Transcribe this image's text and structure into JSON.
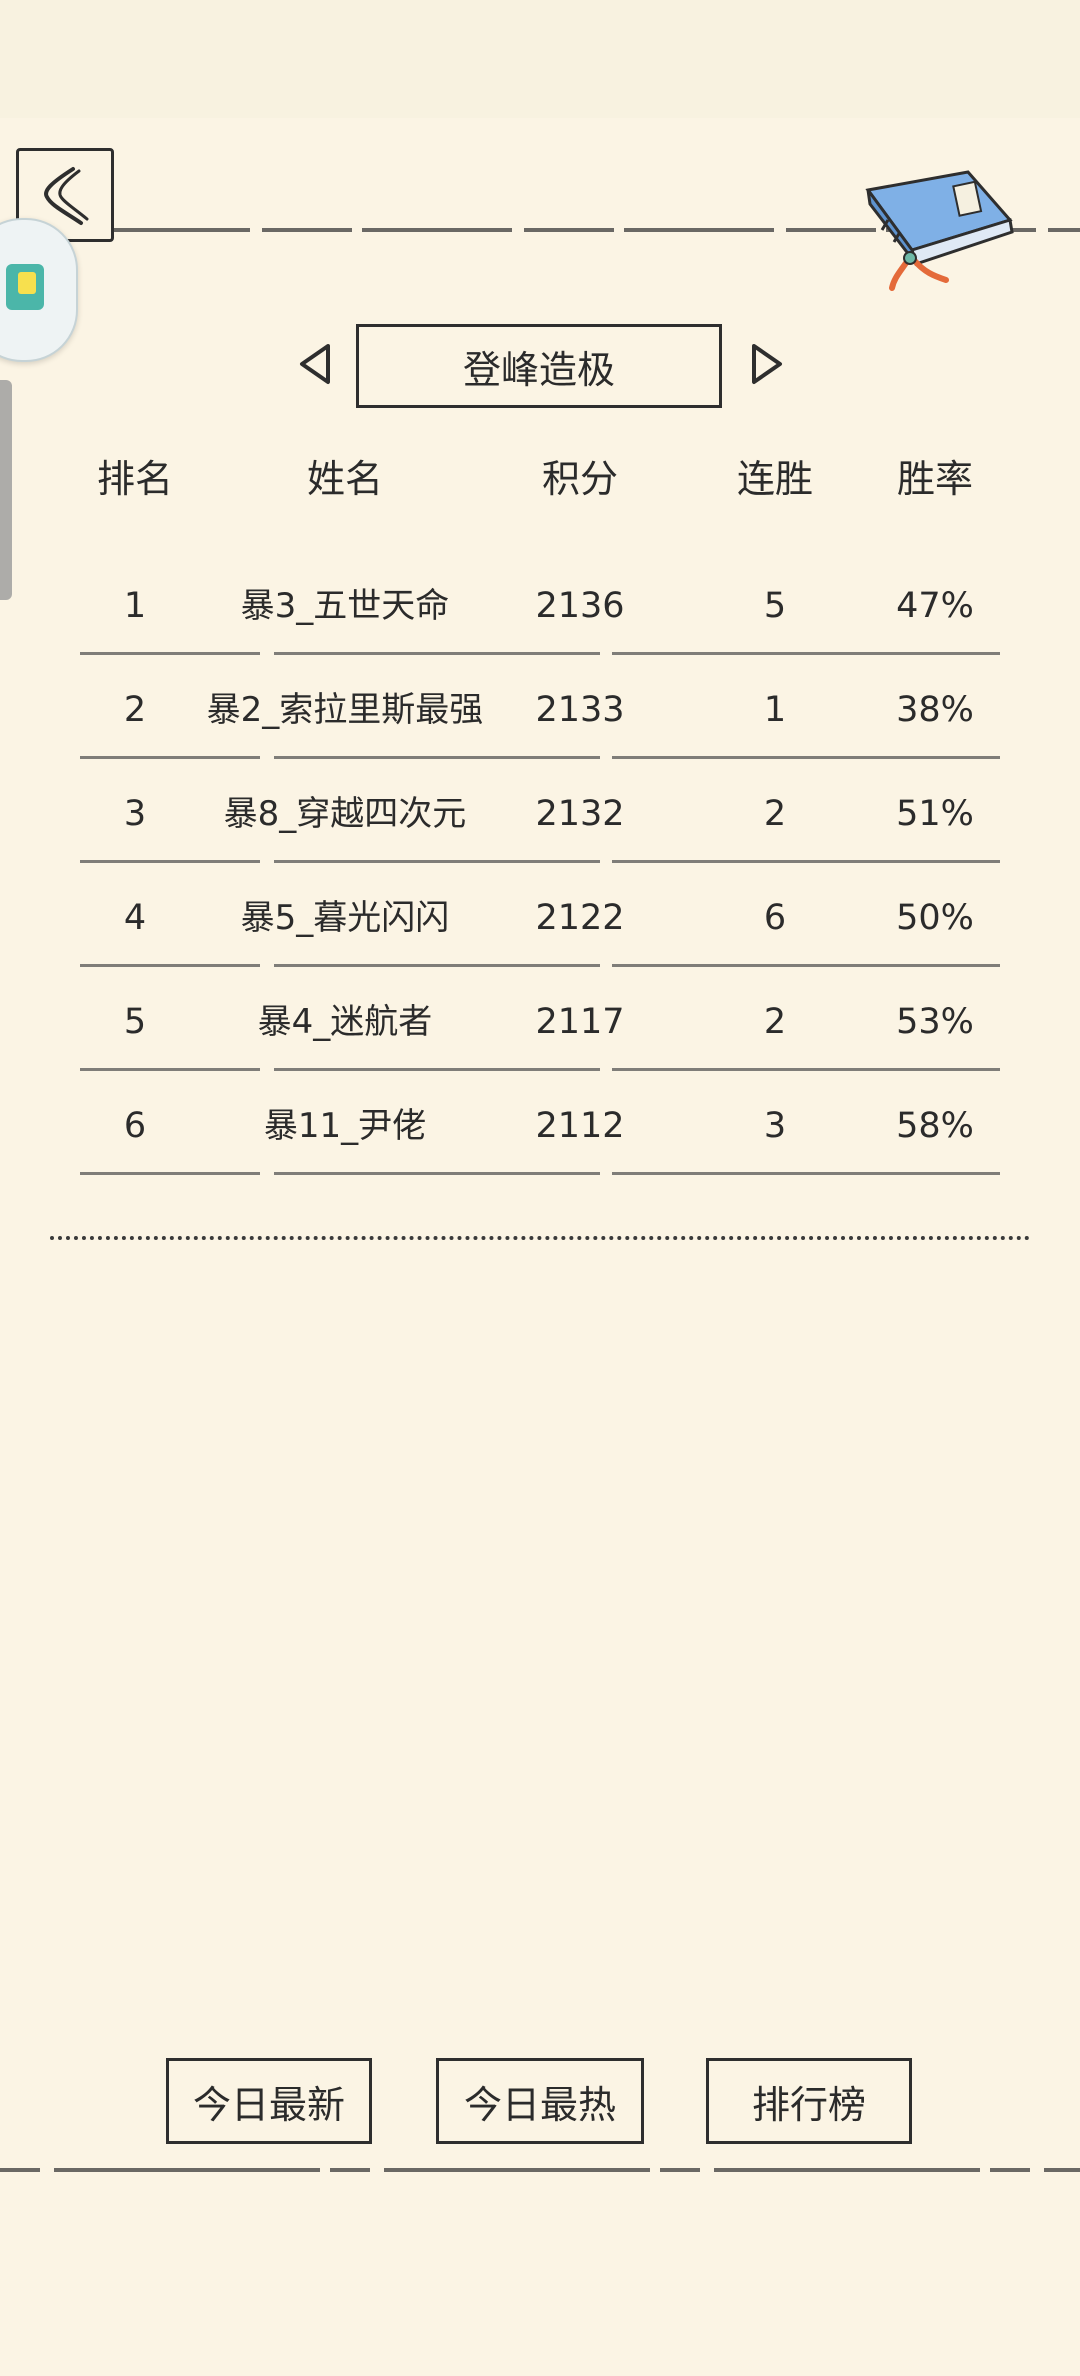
{
  "header": {
    "back_icon": "back-chevron-icon",
    "book_icon": "book-scroll-icon"
  },
  "category": {
    "title": "登峰造极",
    "prev_icon": "triangle-left-icon",
    "next_icon": "triangle-right-icon"
  },
  "table": {
    "headers": {
      "rank": "排名",
      "name": "姓名",
      "score": "积分",
      "streak": "连胜",
      "rate": "胜率"
    },
    "rows": [
      {
        "rank": "1",
        "name": "暴3_五世天命",
        "score": "2136",
        "streak": "5",
        "rate": "47%"
      },
      {
        "rank": "2",
        "name": "暴2_索拉里斯最强",
        "score": "2133",
        "streak": "1",
        "rate": "38%"
      },
      {
        "rank": "3",
        "name": "暴8_穿越四次元",
        "score": "2132",
        "streak": "2",
        "rate": "51%"
      },
      {
        "rank": "4",
        "name": "暴5_暮光闪闪",
        "score": "2122",
        "streak": "6",
        "rate": "50%"
      },
      {
        "rank": "5",
        "name": "暴4_迷航者",
        "score": "2117",
        "streak": "2",
        "rate": "53%"
      },
      {
        "rank": "6",
        "name": "暴11_尹佬",
        "score": "2112",
        "streak": "3",
        "rate": "58%"
      }
    ]
  },
  "bottom_nav": {
    "today_latest": "今日最新",
    "today_hot": "今日最热",
    "leaderboard": "排行榜"
  },
  "colors": {
    "background": "#fbf4e4",
    "ink": "#2e2e2e",
    "book_blue": "#7fb0e6",
    "ribbon": "#e46a3a"
  }
}
